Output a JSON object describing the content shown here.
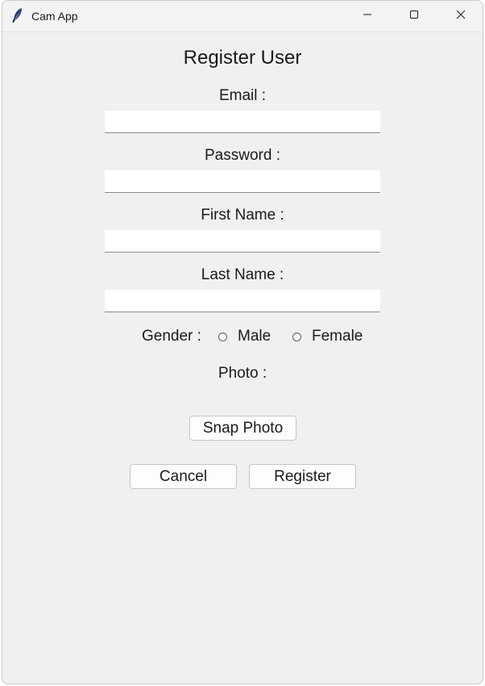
{
  "window": {
    "title": "Cam App",
    "app_icon": "feather-icon",
    "controls": {
      "minimize": "minimize-icon",
      "maximize": "maximize-icon",
      "close": "close-icon"
    }
  },
  "form": {
    "heading": "Register User",
    "email": {
      "label": "Email :",
      "value": ""
    },
    "password": {
      "label": "Password :",
      "value": ""
    },
    "first_name": {
      "label": "First Name :",
      "value": ""
    },
    "last_name": {
      "label": "Last Name :",
      "value": ""
    },
    "gender": {
      "label": "Gender :",
      "options": [
        "Male",
        "Female"
      ],
      "selected": null
    },
    "photo": {
      "label": "Photo :"
    },
    "buttons": {
      "snap": "Snap Photo",
      "cancel": "Cancel",
      "register": "Register"
    }
  },
  "colors": {
    "window_bg": "#f0f0f0",
    "titlebar_bg": "#f3f3f3",
    "input_bg": "#ffffff"
  }
}
